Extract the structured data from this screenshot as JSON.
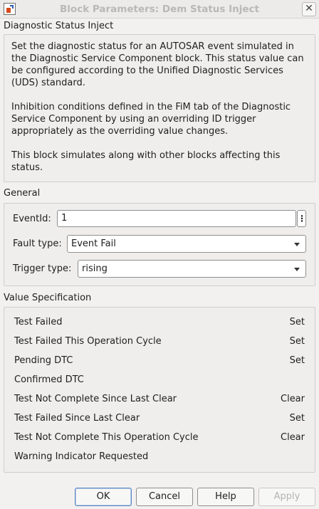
{
  "window": {
    "title": "Block Parameters: Dem Status Inject",
    "app_icon": "simulink-block-icon",
    "close_glyph": "✕"
  },
  "description": {
    "heading": "Diagnostic Status Inject",
    "paragraphs": [
      "Set the diagnostic status for an AUTOSAR event simulated in the Diagnostic Service Component block. This status value can be configured according to the Unified Diagnostic Services (UDS) standard.",
      "Inhibition conditions defined in the FiM tab of the Diagnostic Service Component by using an overriding ID trigger appropriately as the overriding value changes.",
      "This block simulates along with other blocks affecting this status."
    ]
  },
  "general": {
    "heading": "General",
    "event_id": {
      "label": "EventId:",
      "value": "1",
      "menu_glyph": "⋮"
    },
    "fault_type": {
      "label": "Fault type:",
      "value": "Event Fail"
    },
    "trigger_type": {
      "label": "Trigger type:",
      "value": "rising"
    }
  },
  "value_spec": {
    "heading": "Value Specification",
    "rows": [
      {
        "name": "Test Failed",
        "value": "Set"
      },
      {
        "name": "Test Failed This Operation Cycle",
        "value": "Set"
      },
      {
        "name": "Pending DTC",
        "value": "Set"
      },
      {
        "name": "Confirmed DTC",
        "value": ""
      },
      {
        "name": "Test Not Complete Since Last Clear",
        "value": "Clear"
      },
      {
        "name": "Test Failed Since Last Clear",
        "value": "Set"
      },
      {
        "name": "Test Not Complete This Operation Cycle",
        "value": "Clear"
      },
      {
        "name": "Warning Indicator Requested",
        "value": ""
      }
    ]
  },
  "buttons": {
    "ok": "OK",
    "cancel": "Cancel",
    "help": "Help",
    "apply": "Apply"
  }
}
